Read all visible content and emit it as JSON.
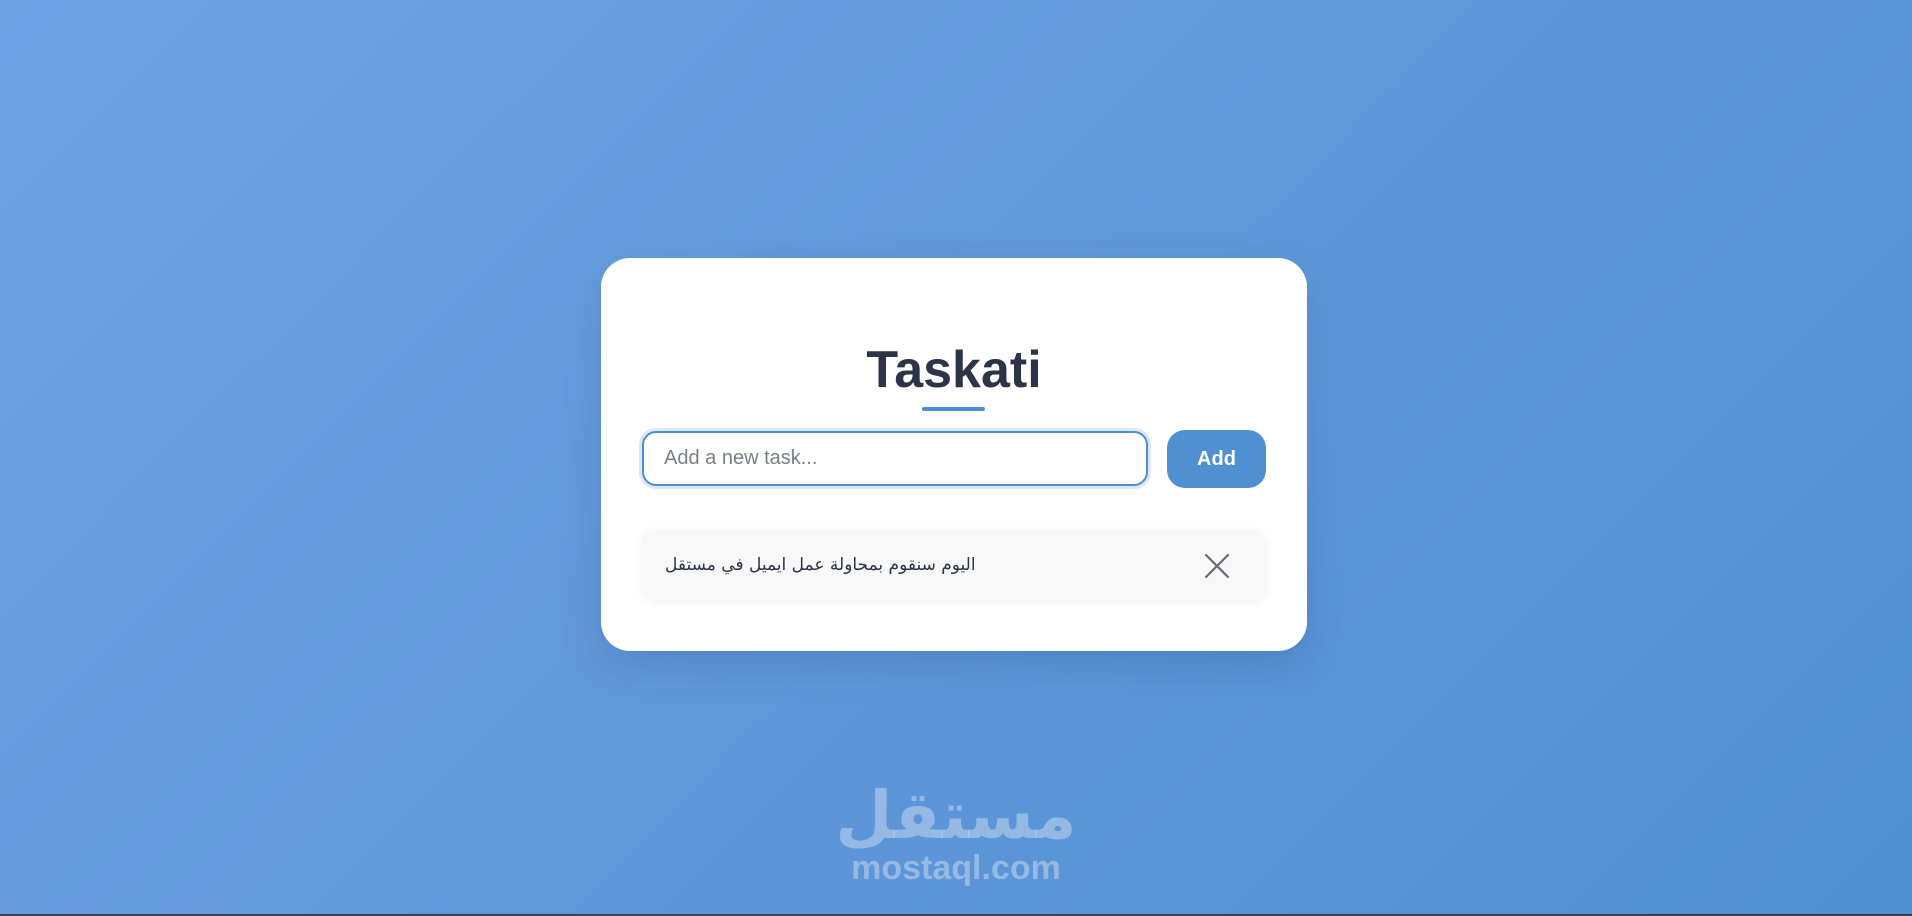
{
  "app": {
    "title": "Taskati"
  },
  "input": {
    "placeholder": "Add a new task...",
    "value": ""
  },
  "add_button": {
    "label": "Add"
  },
  "tasks": [
    {
      "text": "اليوم سنقوم بمحاولة عمل ايميل في مستقل",
      "delete_icon": "close-icon"
    }
  ],
  "watermark": {
    "arabic": "مستقل",
    "latin": "mostaql.com"
  },
  "colors": {
    "accent": "#4e90d2",
    "title": "#2c3447",
    "background_start": "#6fa3e6",
    "background_end": "#4f8fd2"
  }
}
